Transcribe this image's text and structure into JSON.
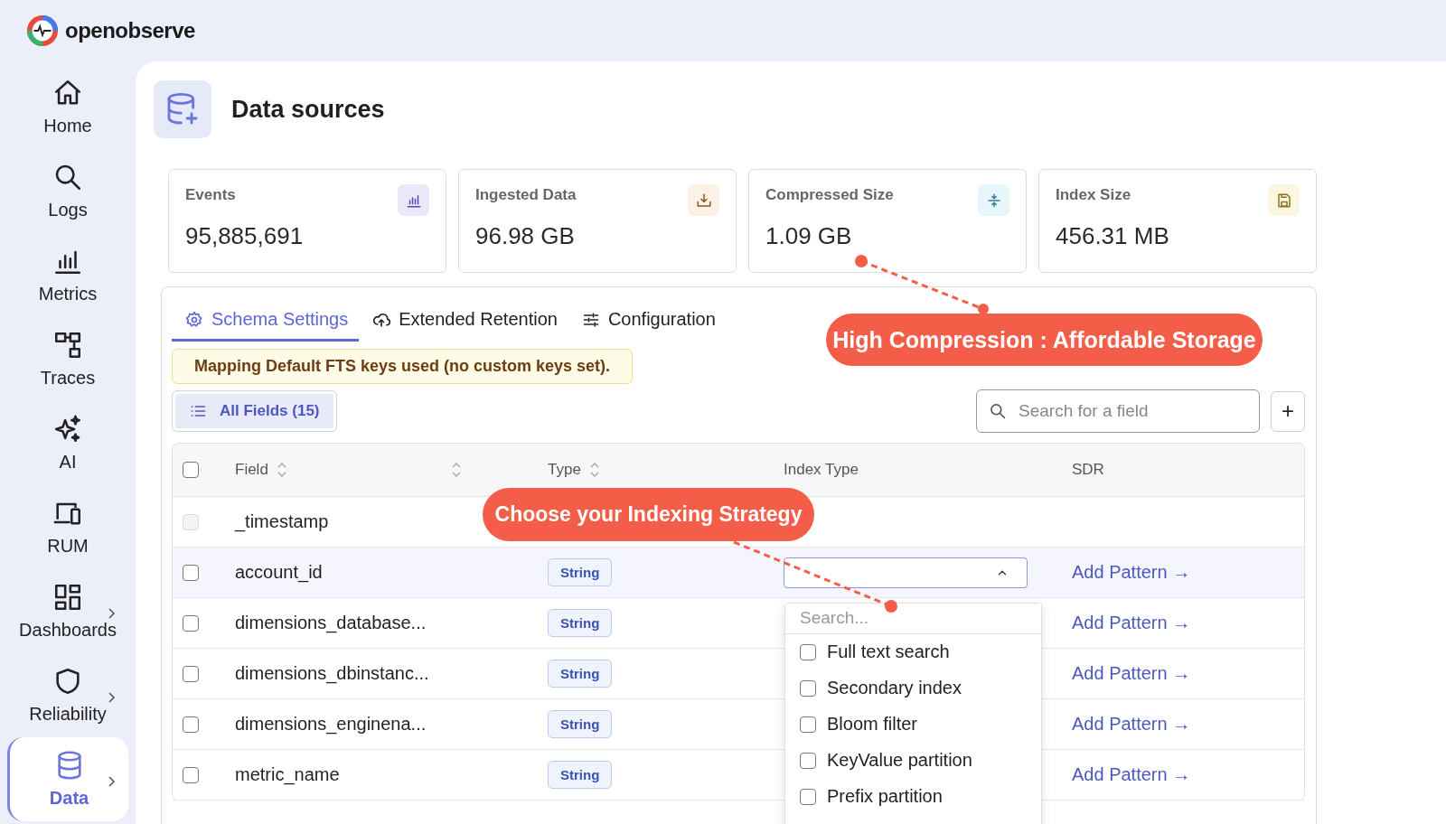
{
  "brand": "openobserve",
  "nav": [
    {
      "label": "Home",
      "kind": "home",
      "selected": false,
      "submenu": false
    },
    {
      "label": "Logs",
      "kind": "search",
      "selected": false,
      "submenu": false
    },
    {
      "label": "Metrics",
      "kind": "bars",
      "selected": false,
      "submenu": false
    },
    {
      "label": "Traces",
      "kind": "traces",
      "selected": false,
      "submenu": false
    },
    {
      "label": "AI",
      "kind": "sparkle",
      "selected": false,
      "submenu": false
    },
    {
      "label": "RUM",
      "kind": "devices",
      "selected": false,
      "submenu": false
    },
    {
      "label": "Dashboards",
      "kind": "dashboard",
      "selected": false,
      "submenu": true
    },
    {
      "label": "Reliability",
      "kind": "shield",
      "selected": false,
      "submenu": true
    },
    {
      "label": "Data",
      "kind": "database",
      "selected": true,
      "submenu": true
    }
  ],
  "page": {
    "title": "Data sources"
  },
  "stats": [
    {
      "label": "Events",
      "value": "95,885,691",
      "kind": "bars",
      "color": "#ebe8fb"
    },
    {
      "label": "Ingested Data",
      "value": "96.98 GB",
      "kind": "download",
      "color": "#fbf1e4"
    },
    {
      "label": "Compressed Size",
      "value": "1.09 GB",
      "kind": "compress",
      "color": "#e6f6fb"
    },
    {
      "label": "Index Size",
      "value": "456.31 MB",
      "kind": "save",
      "color": "#fbf6e2"
    }
  ],
  "tabs": [
    {
      "label": "Schema Settings",
      "kind": "gear",
      "selected": true
    },
    {
      "label": "Extended Retention",
      "kind": "cloud",
      "selected": false
    },
    {
      "label": "Configuration",
      "kind": "sliders",
      "selected": false
    }
  ],
  "notice": "Mapping Default FTS keys used (no custom keys set).",
  "filter_button": "All Fields (15)",
  "search": {
    "placeholder": "Search for a field"
  },
  "add_button": "+",
  "table": {
    "columns": [
      "Field",
      "Type",
      "Index Type",
      "SDR"
    ],
    "select_all": {
      "checked": false
    },
    "rows": [
      {
        "field": "_timestamp",
        "checked": false,
        "disabled": true
      },
      {
        "field": "account_id",
        "type": "String",
        "checked": false,
        "disabled": false,
        "index_select": {
          "open": true
        },
        "sdr": "Add Pattern →"
      },
      {
        "field": "dimensions_database...",
        "type": "String",
        "checked": false,
        "disabled": false,
        "sdr": "Add Pattern →"
      },
      {
        "field": "dimensions_dbinstanc...",
        "type": "String",
        "checked": false,
        "disabled": false,
        "sdr": "Add Pattern →"
      },
      {
        "field": "dimensions_enginena...",
        "type": "String",
        "checked": false,
        "disabled": false,
        "sdr": "Add Pattern →"
      },
      {
        "field": "metric_name",
        "type": "String",
        "checked": false,
        "disabled": false,
        "sdr": "Add Pattern →"
      }
    ]
  },
  "index_dropdown": {
    "placeholder": "Search...",
    "options": [
      {
        "label": "Full text search",
        "checked": false
      },
      {
        "label": "Secondary index",
        "checked": false
      },
      {
        "label": "Bloom filter",
        "checked": false
      },
      {
        "label": "KeyValue partition",
        "checked": false
      },
      {
        "label": "Prefix partition",
        "checked": false
      }
    ]
  },
  "annotations": [
    {
      "text": "High Compression : Affordable Storage"
    },
    {
      "text": "Choose your Indexing Strategy"
    }
  ]
}
